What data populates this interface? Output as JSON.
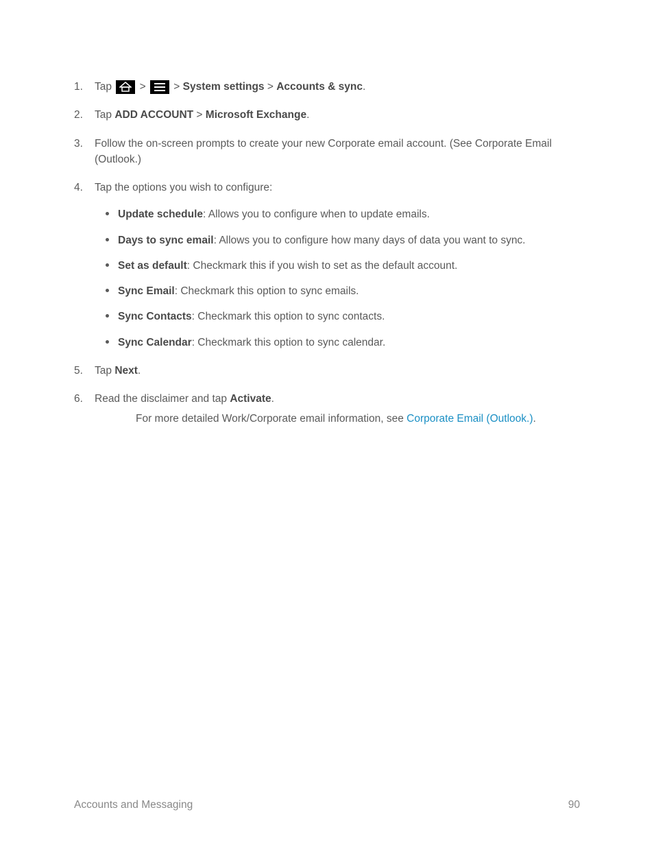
{
  "steps": {
    "s1": {
      "tap": "Tap ",
      "gt1": " > ",
      "gt2": " > ",
      "system_settings": "System settings",
      "gt3": " > ",
      "accounts_sync": "Accounts & sync",
      "period": "."
    },
    "s2": {
      "tap": "Tap ",
      "add_account": "ADD ACCOUNT",
      "gt": " > ",
      "microsoft_exchange": "Microsoft Exchange",
      "period": "."
    },
    "s3": {
      "text": "Follow the on-screen prompts to create your new Corporate email account. (See Corporate Email (Outlook.)"
    },
    "s4": {
      "text": "Tap the options you wish to configure:",
      "bullets": {
        "b1": {
          "bold": "Update schedule",
          "rest": ": Allows you to configure when to update emails."
        },
        "b2": {
          "bold": "Days to sync email",
          "rest": ": Allows you to configure how many days of data you want to sync."
        },
        "b3": {
          "bold": "Set as default",
          "rest": ": Checkmark this if you wish to set as the default account."
        },
        "b4": {
          "bold": "Sync Email",
          "rest": ": Checkmark this option to sync emails."
        },
        "b5": {
          "bold": "Sync Contacts",
          "rest": ": Checkmark this option to sync contacts."
        },
        "b6": {
          "bold": "Sync Calendar",
          "rest": ": Checkmark this option to sync calendar."
        }
      }
    },
    "s5": {
      "tap": "Tap ",
      "next": "Next",
      "period": "."
    },
    "s6": {
      "pre": "Read the disclaimer and tap ",
      "activate": "Activate",
      "period": "."
    }
  },
  "note": {
    "pre": "For more detailed Work/Corporate email information, see ",
    "link": "Corporate Email (Outlook.)",
    "period": "."
  },
  "footer": {
    "section": "Accounts and Messaging",
    "page": "90"
  }
}
